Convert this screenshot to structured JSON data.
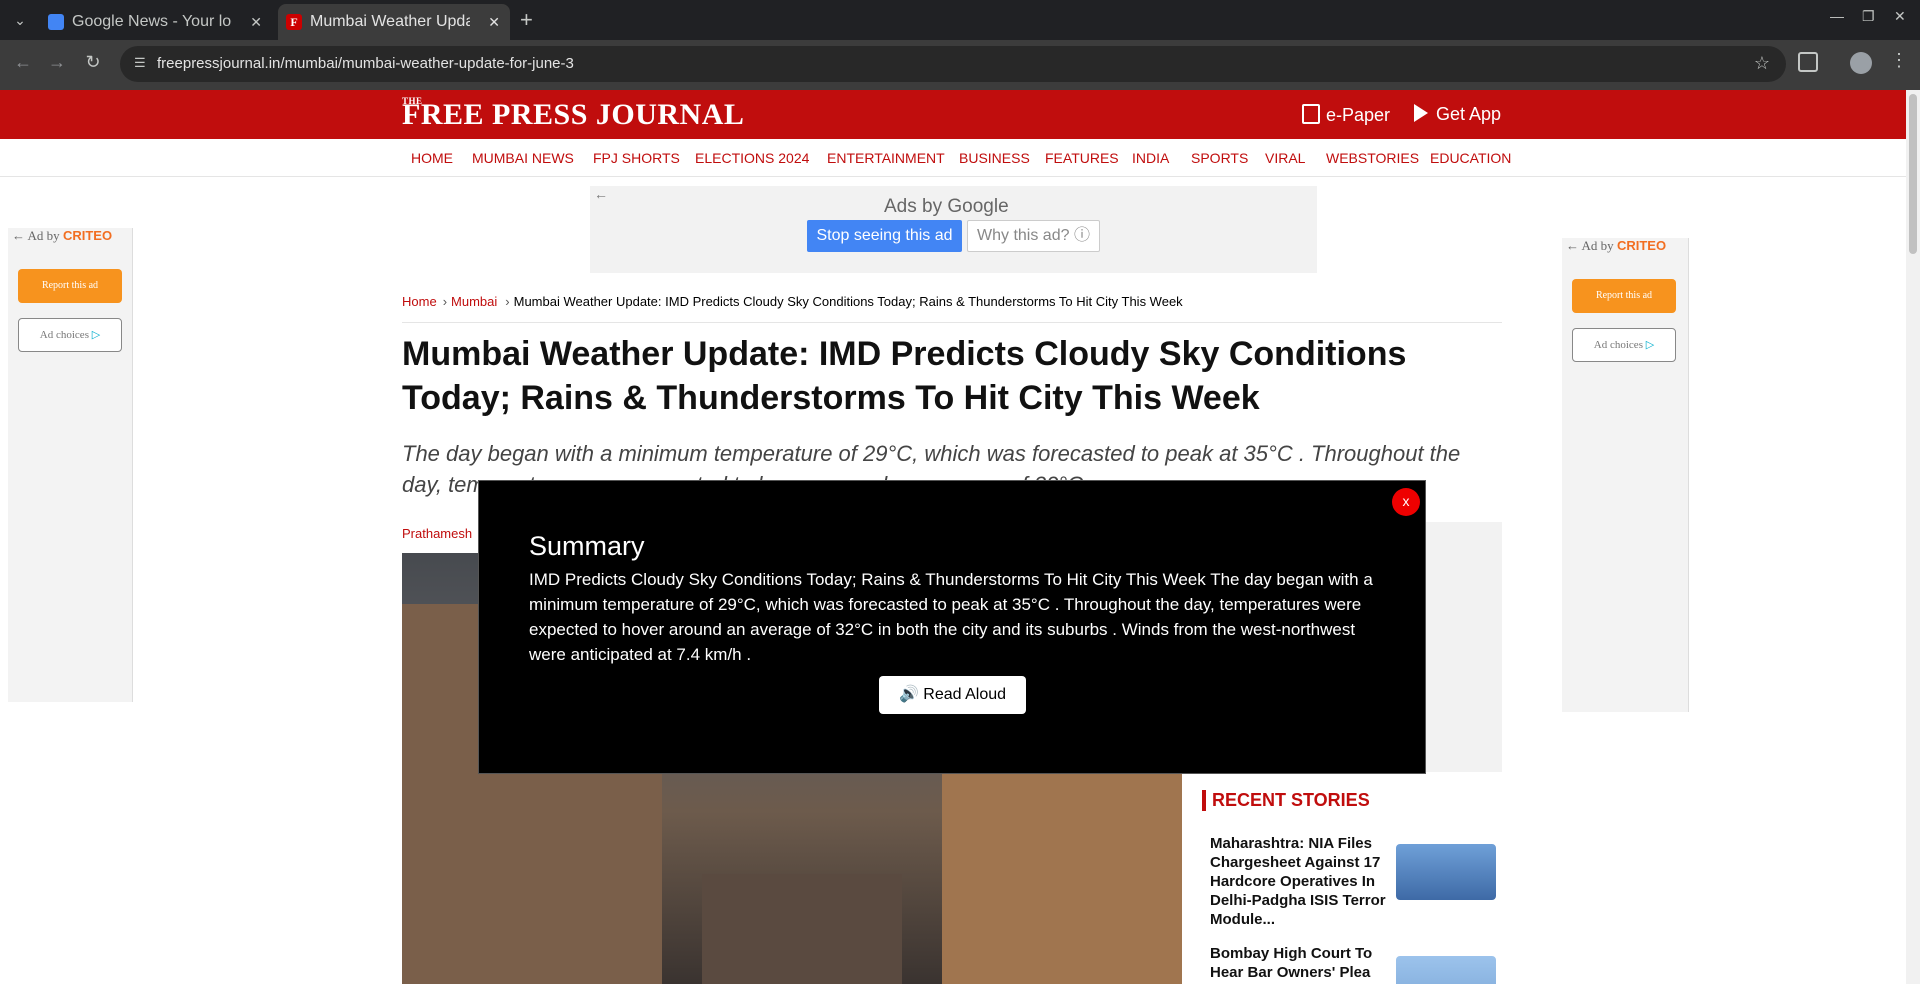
{
  "browser": {
    "tabs": [
      {
        "title": "Google News - Your loca",
        "favicon": "google-news-icon",
        "active": false
      },
      {
        "title": "Mumbai Weather Upda",
        "favicon": "fpj-icon",
        "favicon_text": "F",
        "active": true
      }
    ],
    "url": "freepressjournal.in/mumbai/mumbai-weather-update-for-june-3"
  },
  "site": {
    "logo_the": "THE",
    "logo": "FREE PRESS JOURNAL",
    "epaper": "e-Paper",
    "get_app": "Get App",
    "brand_color": "#c00d0d"
  },
  "nav": {
    "items": [
      "HOME",
      "MUMBAI NEWS",
      "FPJ SHORTS",
      "ELECTIONS 2024",
      "ENTERTAINMENT",
      "BUSINESS",
      "FEATURES",
      "INDIA",
      "SPORTS",
      "VIRAL",
      "WEBSTORIES",
      "EDUCATION"
    ]
  },
  "ads": {
    "criteo_prefix": "Ad by",
    "criteo_brand": "CRITEO",
    "report": "Report this ad",
    "choices": "Ad choices",
    "google_label": "Ads by Google",
    "stop": "Stop seeing this ad",
    "why": "Why this ad?"
  },
  "breadcrumb": {
    "home": "Home",
    "section": "Mumbai",
    "current": "Mumbai Weather Update: IMD Predicts Cloudy Sky Conditions Today; Rains & Thunderstorms To Hit City This Week"
  },
  "article": {
    "headline": "Mumbai Weather Update: IMD Predicts Cloudy Sky Conditions Today; Rains & Thunderstorms To Hit City This Week",
    "dek": "The day began with a minimum temperature of 29°C, which was forecasted to peak at 35°C . Throughout the day, temperatures were expected to hover around an average of 32°C",
    "author": "Prathamesh"
  },
  "sidebar": {
    "recent_title": "RECENT STORIES",
    "stories": [
      {
        "title": "Maharashtra: NIA Files Chargesheet Against 17 Hardcore Operatives In Delhi-Padgha ISIS Terror Module..."
      },
      {
        "title": "Bombay High Court To Hear Bar Owners' Plea"
      }
    ]
  },
  "modal": {
    "heading": "Summary",
    "text": "IMD Predicts Cloudy Sky Conditions Today; Rains & Thunderstorms To Hit City This Week The day began with a minimum temperature of 29°C, which was forecasted to peak at 35°C . Throughout the day, temperatures were expected to hover around an average of 32°C in both the city and its suburbs . Winds from the west-northwest were anticipated at 7.4 km/h .",
    "read_aloud": "🔊 Read Aloud",
    "close": "x"
  }
}
